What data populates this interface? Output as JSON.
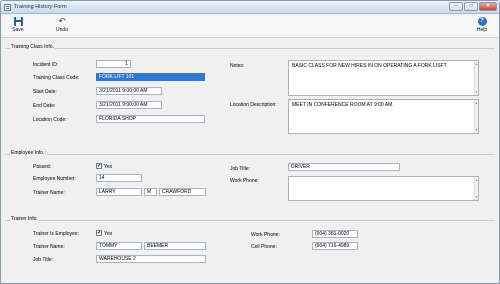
{
  "window": {
    "title": "Training History Form"
  },
  "toolbar": {
    "save_label": "Save",
    "undo_label": "Undo",
    "help_label": "Help",
    "help_glyph": "?"
  },
  "training_class": {
    "group_title": "Training Class Info.",
    "incident_id_label": "Incident ID:",
    "incident_id": "1",
    "class_code_label": "Training Class Code:",
    "class_code": "FORK LIFT 101",
    "start_date_label": "Start Date:",
    "start_date": "3/21/2011 9:00:00 AM",
    "end_date_label": "End Date:",
    "end_date": "3/21/2011 9:00:00 AM",
    "location_code_label": "Location Code:",
    "location_code": "FLORIDA SHOP",
    "notes_label": "Notes:",
    "notes": "BASIC CLASS FOR NEW HIRES IN ON OPERATING A FORK LISFT",
    "location_desc_label": "Location Description:",
    "location_desc": "MEET IN CONFERENCE ROOM AT 9:00 AM."
  },
  "employee": {
    "group_title": "Employee Info.:",
    "passed_label": "Passed:",
    "passed_text": "Yes",
    "employee_number_label": "Employee Number:",
    "employee_number": "14",
    "trainer_name_label": "Trainer Name:",
    "first_name": "LARRY",
    "middle": "M",
    "last_name": "CRAWFORD",
    "job_title_label": "Job Title:",
    "job_title": "DRIVER",
    "work_phone_label": "Work Phone:",
    "work_phone": ""
  },
  "trainer": {
    "group_title": "Trainer Info.",
    "is_employee_label": "Trainer Is Employee:",
    "is_employee_text": "Yes",
    "trainer_name_label": "Trainer Name:",
    "first_name": "TOMMY",
    "last_name": "BEEMER",
    "job_title_label": "Job Title:",
    "job_title": "WAREHOUSE 2",
    "work_phone_label": "Work Phone:",
    "work_phone": "(904) 381-0020",
    "cell_phone_label": "Cell Phone:",
    "cell_phone": "(904) 716-4989"
  },
  "icons": {
    "save": "save-icon",
    "undo": "undo-icon",
    "help": "help-icon",
    "checkbox_mark": "✔"
  }
}
